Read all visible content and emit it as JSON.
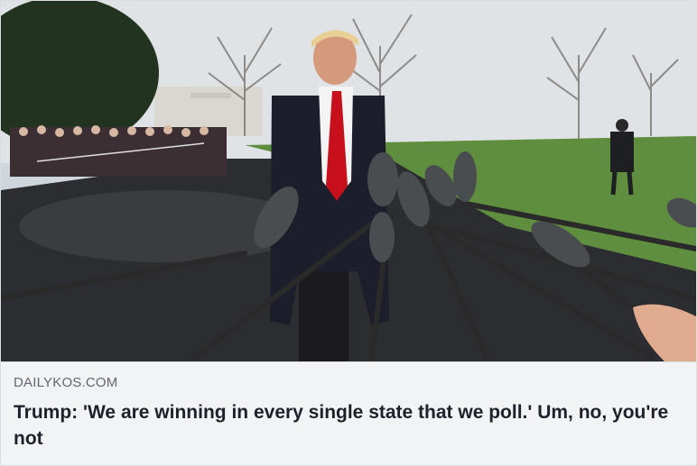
{
  "link_preview": {
    "image_description_icon": "news-photo",
    "domain": "DAILYKOS.COM",
    "headline": "Trump: 'We are winning in every single state that we poll.' Um, no, you're not"
  },
  "colors": {
    "meta_background": "#f2f3f5",
    "domain_text": "#606770",
    "headline_text": "#1d2129"
  }
}
